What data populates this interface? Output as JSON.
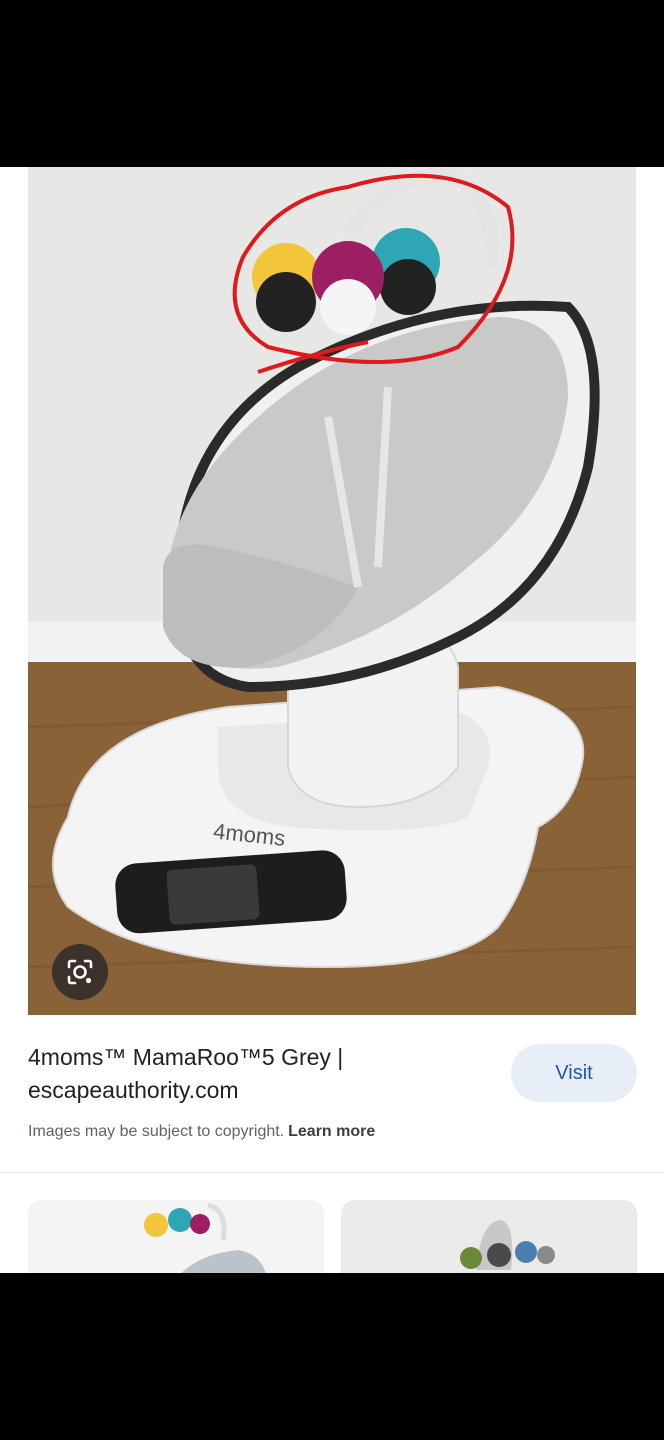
{
  "result": {
    "title_line1": "4moms™ MamaRoo™5 Grey |",
    "title_line2": "escapeauthority.com",
    "visit_label": "Visit",
    "copyright_text": "Images may be subject to copyright.",
    "learn_more_label": "Learn more"
  },
  "image": {
    "brand_logo_text": "4moms",
    "annotation_color": "#e0191d"
  },
  "icons": {
    "lens": "google-lens-icon"
  },
  "colors": {
    "visit_bg": "#e8eef8",
    "visit_text": "#1a57b8",
    "link_text": "#3c4043"
  }
}
